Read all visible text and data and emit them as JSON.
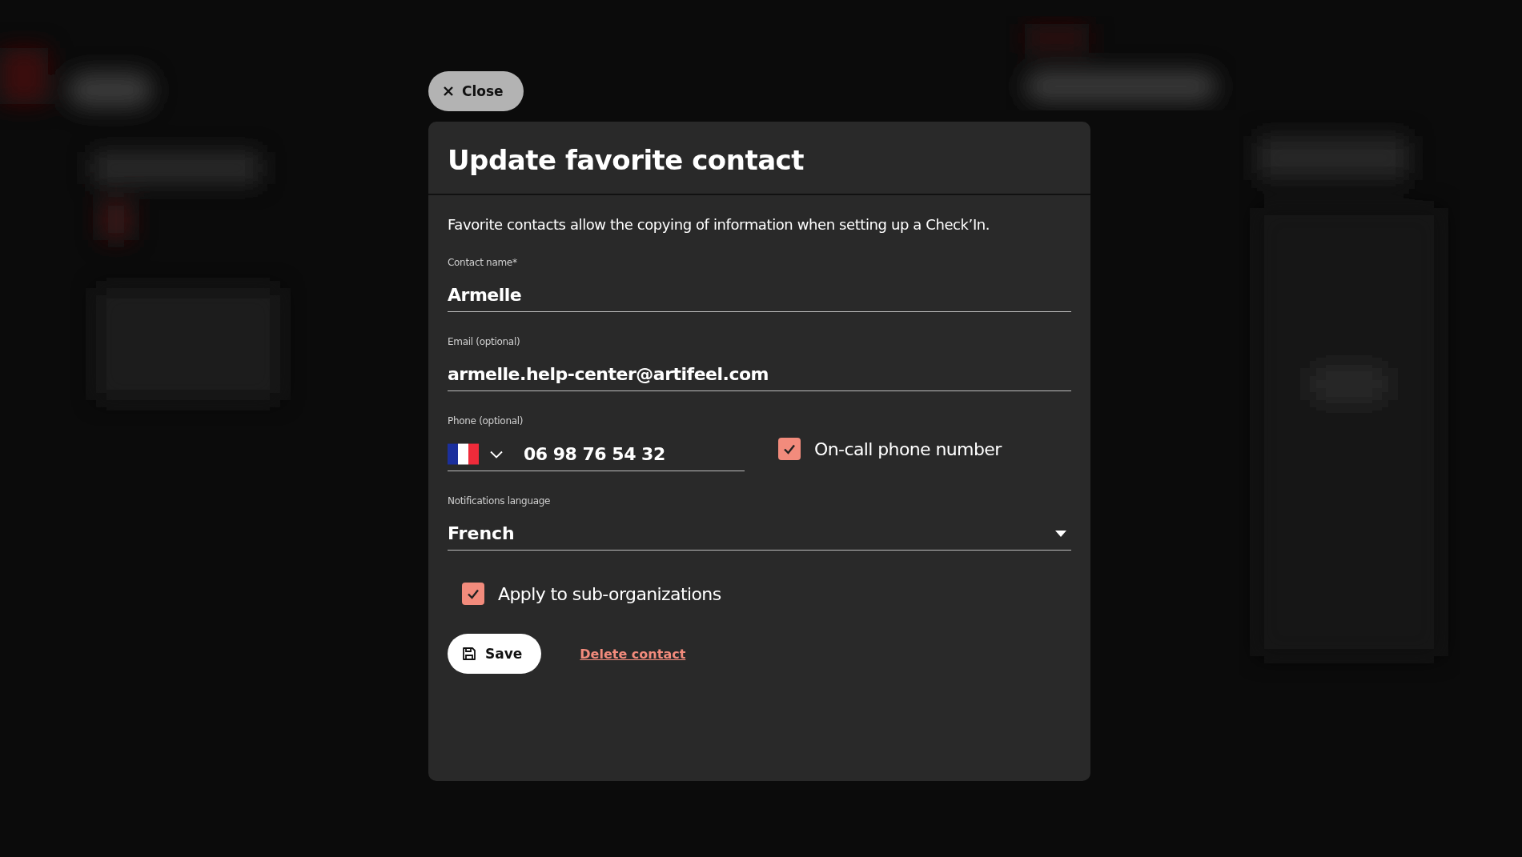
{
  "close_button": {
    "label": "Close"
  },
  "dialog": {
    "title": "Update favorite contact",
    "description": "Favorite contacts allow the copying of information when setting up a Check’In.",
    "contact_name": {
      "label": "Contact name*",
      "value": "Armelle"
    },
    "email": {
      "label": "Email (optional)",
      "value": "armelle.help-center@artifeel.com"
    },
    "phone": {
      "label": "Phone (optional)",
      "value": "06 98 76 54 32"
    },
    "on_call": {
      "label": "On-call phone number",
      "checked": true
    },
    "language": {
      "label": "Notifications language",
      "value": "French"
    },
    "apply_sub_orgs": {
      "label": "Apply to sub-organizations",
      "checked": true
    },
    "save_button": {
      "label": "Save"
    },
    "delete_link": {
      "label": "Delete contact"
    }
  }
}
